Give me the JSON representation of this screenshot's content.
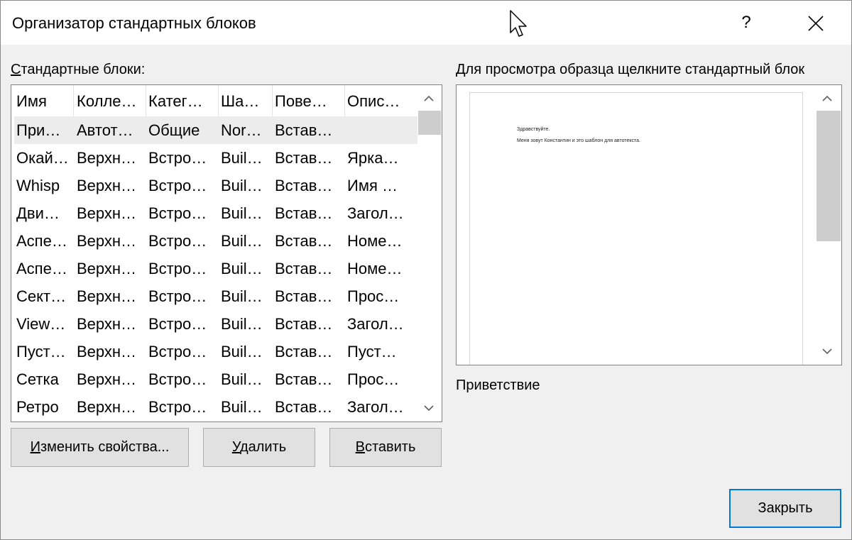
{
  "window": {
    "title": "Организатор стандартных блоков",
    "help_label": "?"
  },
  "list": {
    "label": "Стандартные блоки:",
    "label_access_key": "С",
    "label_rest": "тандартные блоки:",
    "columns": [
      "Имя",
      "Колле…",
      "Катег…",
      "Ша…",
      "Пове…",
      "Опис…"
    ],
    "selected_index": 0,
    "rows": [
      [
        "При…",
        "Автот…",
        "Общие",
        "Nor…",
        "Встав…",
        ""
      ],
      [
        "Окай…",
        "Верхн…",
        "Встро…",
        "Buil…",
        "Встав…",
        "Ярка…"
      ],
      [
        "Whisp",
        "Верхн…",
        "Встро…",
        "Buil…",
        "Встав…",
        "Имя …"
      ],
      [
        "Дви…",
        "Верхн…",
        "Встро…",
        "Buil…",
        "Встав…",
        "Загол…"
      ],
      [
        "Аспе…",
        "Верхн…",
        "Встро…",
        "Buil…",
        "Встав…",
        "Номе…"
      ],
      [
        "Аспе…",
        "Верхн…",
        "Встро…",
        "Buil…",
        "Встав…",
        "Номе…"
      ],
      [
        "Сект…",
        "Верхн…",
        "Встро…",
        "Buil…",
        "Встав…",
        "Прос…"
      ],
      [
        "View…",
        "Верхн…",
        "Встро…",
        "Buil…",
        "Встав…",
        "Загол…"
      ],
      [
        " Пуст…",
        "Верхн…",
        "Встро…",
        "Buil…",
        "Встав…",
        "Пуст…"
      ],
      [
        "Сетка",
        "Верхн…",
        "Встро…",
        "Buil…",
        "Встав…",
        "Прос…"
      ],
      [
        "Ретро",
        "Верхн…",
        "Встро…",
        "Buil…",
        "Встав…",
        "Загол…"
      ]
    ]
  },
  "buttons": {
    "edit": {
      "access_key": "И",
      "rest": "зменить свойства..."
    },
    "delete": {
      "access_key": "У",
      "rest": "далить"
    },
    "insert": {
      "access_key": "В",
      "rest": "ставить"
    },
    "close": "Закрыть"
  },
  "preview": {
    "label": "Для просмотра образца щелкните стандартный блок",
    "lines": [
      "Здравствуйте.",
      "Меня зовут Константин  и это шаблон для автотекста."
    ],
    "block_name": "Приветствие"
  },
  "colors": {
    "accent": "#0078d7",
    "selection": "#ececec",
    "dialog_bg": "#f0f0f0"
  },
  "icons": {
    "help": "question-mark",
    "close": "x-mark",
    "scroll_up": "chevron-up",
    "scroll_down": "chevron-down",
    "cursor": "mouse-pointer"
  }
}
